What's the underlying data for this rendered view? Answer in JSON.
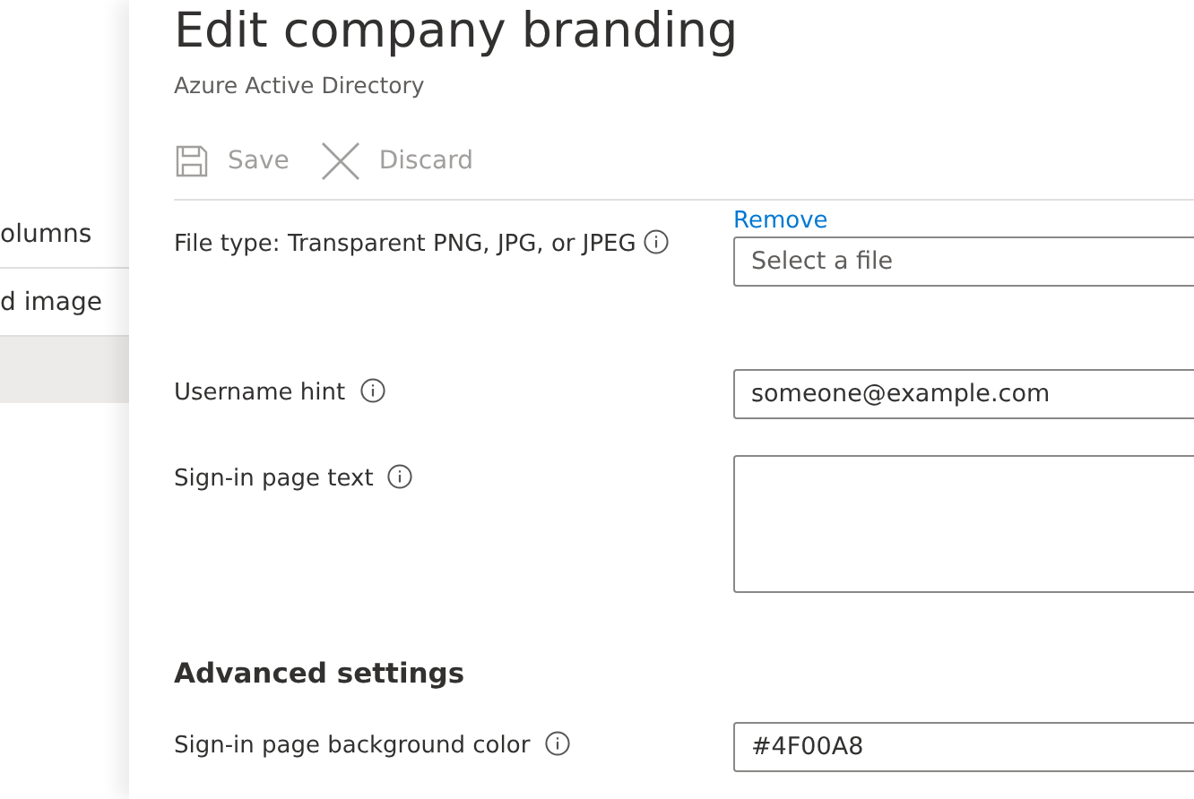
{
  "sidebar": {
    "items": [
      {
        "label": "olumns",
        "selected": false
      },
      {
        "label": "d image",
        "selected": false
      },
      {
        "selected": true
      }
    ]
  },
  "blade": {
    "title": "Edit company branding",
    "subtitle": "Azure Active Directory"
  },
  "toolbar": [
    {
      "kind": "save",
      "label": "Save",
      "disabled": true
    },
    {
      "kind": "discard",
      "label": "Discard",
      "disabled": true
    }
  ],
  "fields": [
    {
      "kind": "file",
      "label": "File type: Transparent PNG, JPG, or JPEG",
      "info": true,
      "link": "Remove",
      "placeholder": "Select a file"
    },
    {
      "kind": "text",
      "label": "Username hint",
      "info": true,
      "value": "someone@example.com"
    },
    {
      "kind": "textarea",
      "label": "Sign-in page text",
      "info": true
    },
    {
      "kind": "heading",
      "label": "Advanced settings"
    },
    {
      "kind": "text",
      "label": "Sign-in page background color",
      "info": true,
      "value": "#4F00A8"
    }
  ]
}
